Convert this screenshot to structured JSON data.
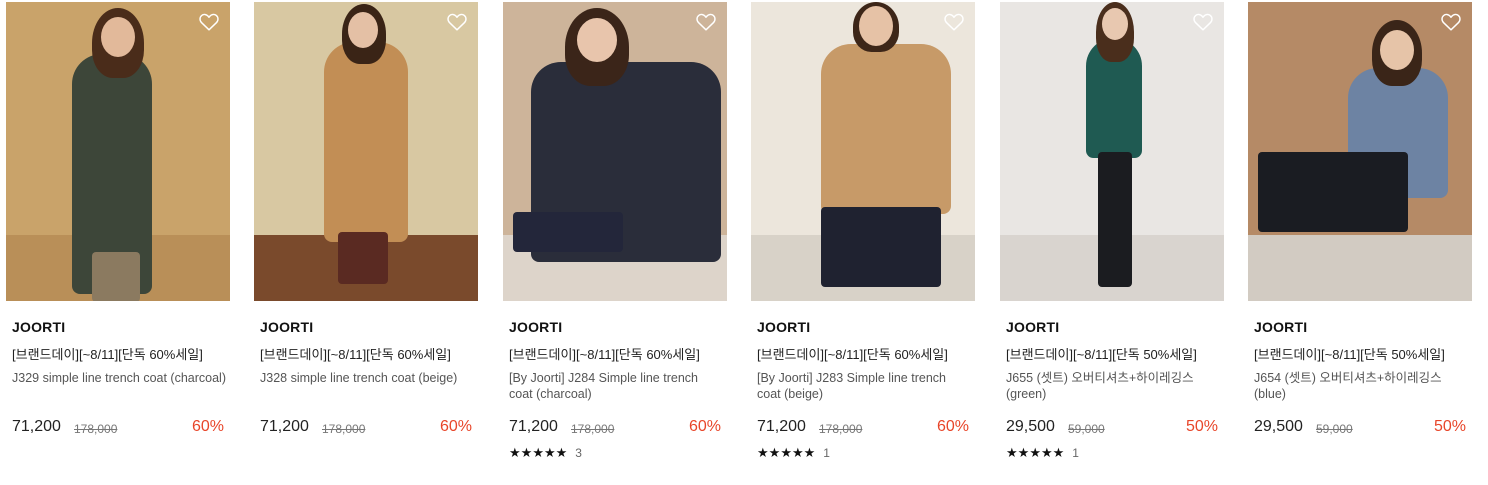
{
  "colors": {
    "discount": "#e8462a",
    "text": "#222222",
    "muted": "#777777"
  },
  "products": [
    {
      "brand": "JOORTI",
      "promo": "[브랜드데이][~8/11][단독 60%세일]",
      "name": "J329 simple line trench coat (charcoal)",
      "price": "71,200",
      "original_price": "178,000",
      "discount": "60%",
      "rating_count": null,
      "stars": null,
      "photo": {
        "wall": "#c9a36a",
        "floor": "#b98f58",
        "coat": "#3d4639",
        "hair": "#4a2c1a",
        "skin": "#e2b99a",
        "legs": "#8b7a60"
      }
    },
    {
      "brand": "JOORTI",
      "promo": "[브랜드데이][~8/11][단독 60%세일]",
      "name": "J328 simple line trench coat (beige)",
      "price": "71,200",
      "original_price": "178,000",
      "discount": "60%",
      "rating_count": null,
      "stars": null,
      "photo": {
        "wall": "#d8c8a2",
        "floor": "#7a4a2c",
        "coat": "#c28e55",
        "hair": "#3a2416",
        "skin": "#e4c0a5",
        "legs": "#5a2a22"
      }
    },
    {
      "brand": "JOORTI",
      "promo": "[브랜드데이][~8/11][단독 60%세일]",
      "name": "[By Joorti] J284 Simple line trench coat (charcoal)",
      "price": "71,200",
      "original_price": "178,000",
      "discount": "60%",
      "rating_count": "3",
      "stars": 5,
      "photo": {
        "wall": "#cdb49a",
        "floor": "#ddd4ca",
        "coat": "#2a2d3a",
        "hair": "#3b2519",
        "skin": "#e8c5ac",
        "legs": "#23263a"
      }
    },
    {
      "brand": "JOORTI",
      "promo": "[브랜드데이][~8/11][단독 60%세일]",
      "name": "[By Joorti] J283 Simple line trench coat (beige)",
      "price": "71,200",
      "original_price": "178,000",
      "discount": "60%",
      "rating_count": "1",
      "stars": 5,
      "photo": {
        "wall": "#ece6dc",
        "floor": "#d8d2c8",
        "coat": "#c79a68",
        "hair": "#3d2618",
        "skin": "#e6c2a6",
        "legs": "#1f2230"
      }
    },
    {
      "brand": "JOORTI",
      "promo": "[브랜드데이][~8/11][단독 50%세일]",
      "name": "J655 (셋트) 오버티셔츠+하이레깅스 (green)",
      "price": "29,500",
      "original_price": "59,000",
      "discount": "50%",
      "rating_count": "1",
      "stars": 5,
      "photo": {
        "wall": "#e9e6e3",
        "floor": "#d9d4cf",
        "coat": "#1f5a52",
        "hair": "#4a2e1c",
        "skin": "#e8c8b0",
        "legs": "#1b1c20"
      }
    },
    {
      "brand": "JOORTI",
      "promo": "[브랜드데이][~8/11][단독 50%세일]",
      "name": "J654 (셋트) 오버티셔츠+하이레깅스 (blue)",
      "price": "29,500",
      "original_price": "59,000",
      "discount": "50%",
      "rating_count": null,
      "stars": null,
      "photo": {
        "wall": "#b58a66",
        "floor": "#d2cbc2",
        "coat": "#6d83a3",
        "hair": "#3a2518",
        "skin": "#e6c4a8",
        "legs": "#1a1c22"
      }
    }
  ]
}
